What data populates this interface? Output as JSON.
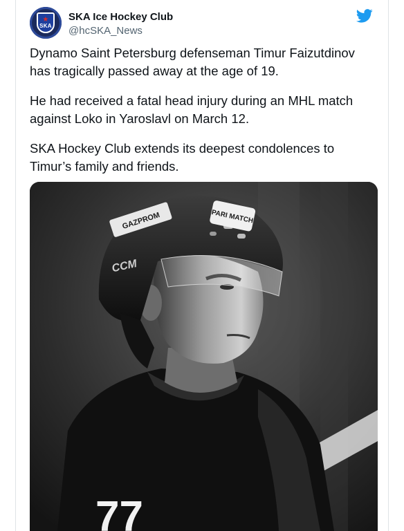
{
  "account": {
    "display_name": "SKA Ice Hockey Club",
    "handle": "@hcSKA_News",
    "avatar_text": "SKA",
    "avatar_icon": "ska-crest-logo"
  },
  "brand_icon": "twitter-bird-icon",
  "colors": {
    "twitter_blue": "#1d9bf0",
    "text_primary": "#0f1419",
    "text_secondary": "#536471",
    "border": "#dfe3e6"
  },
  "tweet": {
    "paragraphs": [
      "Dynamo Saint Petersburg defenseman Timur Faizutdinov has tragically passed away at the age of 19.",
      "He had received a fatal head injury during an MHL match against Loko in Yaroslavl on March 12.",
      "SKA Hockey Club extends its deepest condolences to Timur’s family and friends."
    ]
  },
  "photo": {
    "helmet_brand": "CCM",
    "helmet_sticker_left": "GAZPROM",
    "helmet_sticker_right": "PARI MATCH",
    "jersey_number": "77"
  }
}
